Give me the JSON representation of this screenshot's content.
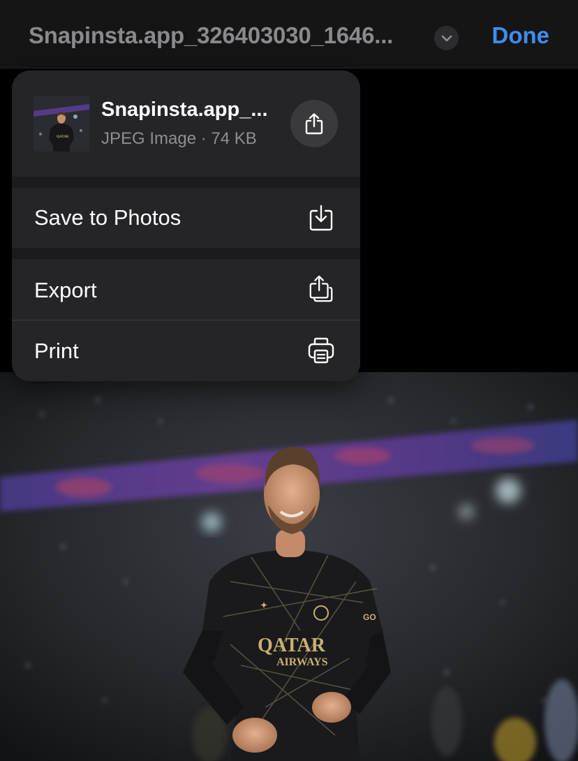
{
  "navbar": {
    "title": "Snapinsta.app_326403030_1646...",
    "done_label": "Done",
    "accent_color": "#3d8ef0"
  },
  "menu": {
    "file": {
      "name": "Snapinsta.app_...",
      "meta": "JPEG Image · 74 KB",
      "thumbnail": "photo-thumbnail",
      "share_icon": "share-icon"
    },
    "items": [
      {
        "label": "Save to Photos",
        "icon": "save-to-photos-icon"
      },
      {
        "label": "Export",
        "icon": "export-icon"
      },
      {
        "label": "Print",
        "icon": "printer-icon"
      }
    ]
  },
  "photo": {
    "description_icon": "football-player-photo",
    "jersey_text_1": "QATAR",
    "jersey_text_2": "AIRWAYS"
  }
}
